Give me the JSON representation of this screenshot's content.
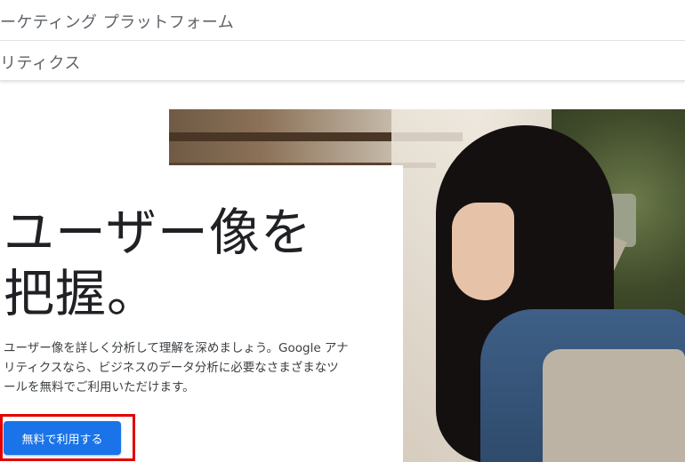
{
  "nav": {
    "primary_label": "ーケティング プラットフォーム",
    "secondary_label": "リティクス"
  },
  "hero": {
    "headline_line1": "ユーザー像を",
    "headline_line2": "把握。",
    "body_line1": "ユーザー像を詳しく分析して理解を深めましょう。Google アナ",
    "body_line2": "リティクスなら、ビジネスのデータ分析に必要なさまざまなツ",
    "body_line3": "ールを無料でご利用いただけます。",
    "cta_label": "無料で利用する"
  },
  "colors": {
    "cta_background": "#1a73e8",
    "highlight_border": "#e00000"
  }
}
